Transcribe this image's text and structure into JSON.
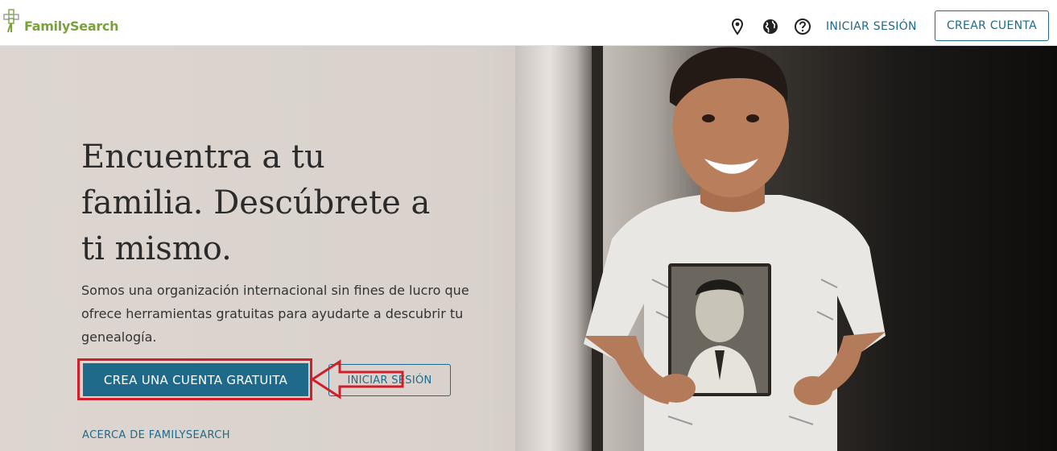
{
  "header": {
    "logo_text": "FamilySearch",
    "icons": [
      "location-icon",
      "globe-icon",
      "help-icon"
    ],
    "signin_label": "INICIAR SESIÓN",
    "create_label": "CREAR CUENTA"
  },
  "hero": {
    "title_lines": [
      "Encuentra a tu",
      "familia. Descúbrete a",
      "ti mismo."
    ],
    "description_lines": [
      "Somos una organización internacional sin fines de lucro que",
      "ofrece herramientas gratuitas para ayudarte a descubrir tu",
      "genealogía."
    ],
    "primary_cta": "CREA UNA CUENTA GRATUITA",
    "secondary_cta": "INICIAR SESIÓN",
    "about_link": "ACERCA DE FAMILYSEARCH"
  },
  "colors": {
    "brand_green": "#7aa23a",
    "link_blue": "#1f6a8a",
    "annotation_red": "#d11f2a"
  }
}
